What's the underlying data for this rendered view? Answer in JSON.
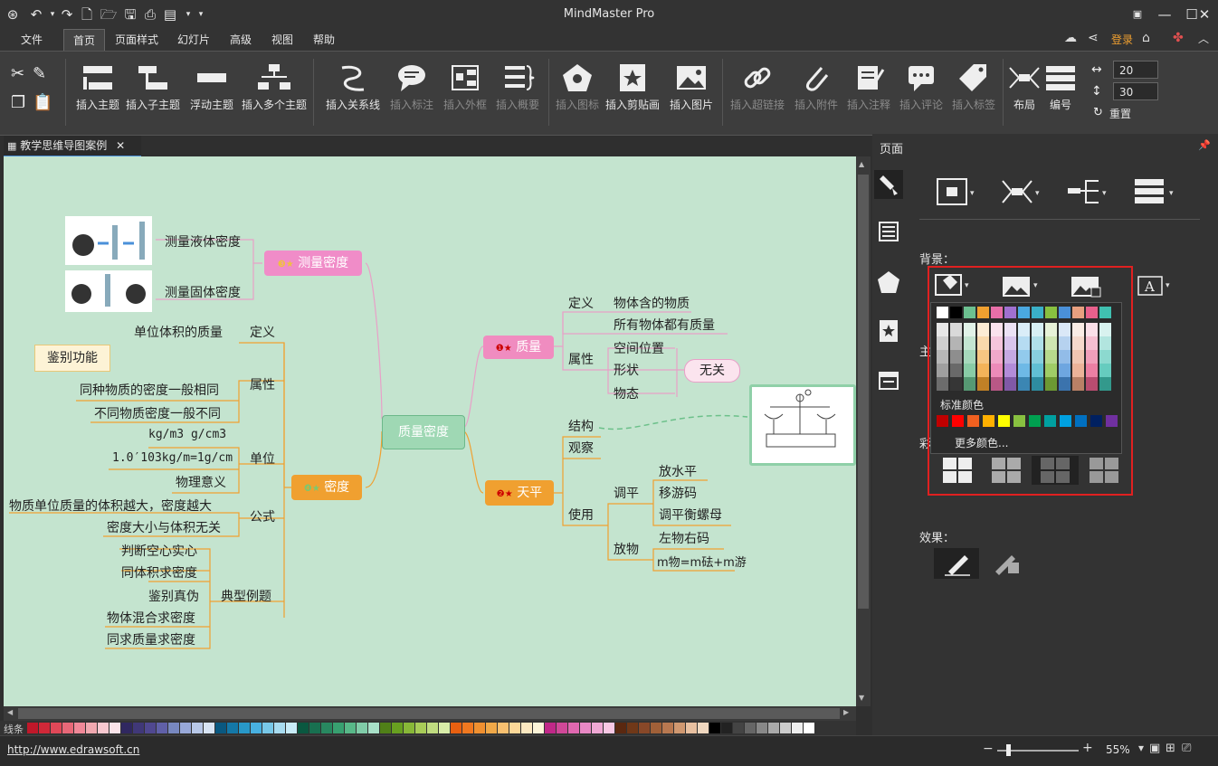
{
  "app": {
    "title": "MindMaster Pro",
    "login": "登录"
  },
  "menu": [
    {
      "label": "文件"
    },
    {
      "label": "首页"
    },
    {
      "label": "页面样式"
    },
    {
      "label": "幻灯片"
    },
    {
      "label": "高级"
    },
    {
      "label": "视图"
    },
    {
      "label": "帮助"
    }
  ],
  "ribbon": {
    "insert_topic": "插入主题",
    "insert_subtopic": "插入子主题",
    "floating_topic": "浮动主题",
    "insert_multi": "插入多个主题",
    "insert_relation": "插入关系线",
    "insert_callout": "插入标注",
    "insert_boundary": "插入外框",
    "insert_summary": "插入概要",
    "insert_icon": "插入图标",
    "insert_clipart": "插入剪贴画",
    "insert_image": "插入图片",
    "insert_hyperlink": "插入超链接",
    "insert_attachment": "插入附件",
    "insert_note": "插入注释",
    "insert_comment": "插入评论",
    "insert_tag": "插入标签",
    "layout": "布局",
    "numbering": "编号",
    "spin_h": "20",
    "spin_v": "30",
    "reset": "重置"
  },
  "doc_tab": "教学思维导图案例",
  "mindmap": {
    "center": "质量密度",
    "mass": {
      "label": "质量",
      "def_label": "定义",
      "def_value": "物体含的物质",
      "all_have": "所有物体都有质量",
      "attr": "属性",
      "attrs": [
        "空间位置",
        "形状",
        "物态"
      ],
      "unrelated": "无关"
    },
    "balance": {
      "label": "天平",
      "structure": "结构",
      "observe": "观察",
      "use": "使用",
      "adjust": "调平",
      "adjust_items": [
        "放水平",
        "移游码",
        "调平衡螺母"
      ],
      "place": "放物",
      "place_items": [
        "左物右码",
        "m物=m砝+m游"
      ]
    },
    "measure": {
      "label": "测量密度",
      "liquid": "测量液体密度",
      "solid": "测量固体密度"
    },
    "density": {
      "label": "密度",
      "def_label": "定义",
      "def_value": "单位体积的质量",
      "attr": "属性",
      "callout": "鉴别功能",
      "attr_items": [
        "同种物质的密度一般相同",
        "不同物质密度一般不同"
      ],
      "unit": "单位",
      "unit_items": [
        "kg/m3   g/cm3",
        "1.0′103kg/m=1g/cm",
        "物理意义"
      ],
      "formula": "公式",
      "formula_items": [
        "物质单位质量的体积越大，密度越大",
        "密度大小与体积无关"
      ],
      "example": "典型例题",
      "example_items": [
        "判断空心实心",
        "同体积求密度",
        "鉴别真伪",
        "物体混合求密度",
        "同求质量求密度"
      ]
    }
  },
  "palette_label": "线条",
  "status": {
    "url": "http://www.edrawsoft.cn",
    "zoom": "55%"
  },
  "panel": {
    "title": "页面",
    "background": "背景：",
    "standard_colors": "标准颜色",
    "more_colors": "更多颜色...",
    "effect": "效果：",
    "partial1": "主",
    "partial2": "彩"
  },
  "colors": {
    "accent": "#4a90d9",
    "canvas": "#c4e4cf",
    "mass_topic": "#e8619a",
    "balance_topic": "#f0a030",
    "measure_topic": "#e880c0",
    "density_topic": "#f0a030",
    "center_topic": "#7cc8a0",
    "highlight": "#e02020"
  }
}
